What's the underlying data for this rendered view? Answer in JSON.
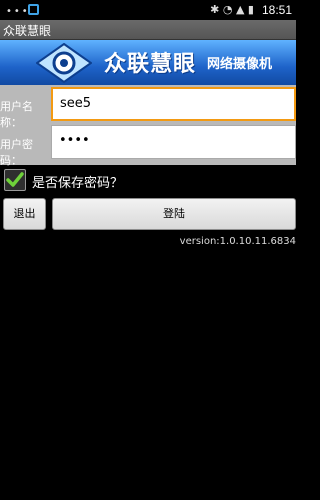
{
  "status_bar": {
    "time": "18:51"
  },
  "app": {
    "title": "众联慧眼"
  },
  "banner": {
    "brand": "众联慧眼",
    "subtitle": "网络摄像机"
  },
  "login_form": {
    "username_label": "用户名称：",
    "username_value": "see5",
    "password_label": "用户密码：",
    "password_value": "••••",
    "save_password_label": "是否保存密码？",
    "save_password_checked": true,
    "exit_button": "退出",
    "login_button": "登陆"
  },
  "version": "version:1.0.10.11.6834"
}
